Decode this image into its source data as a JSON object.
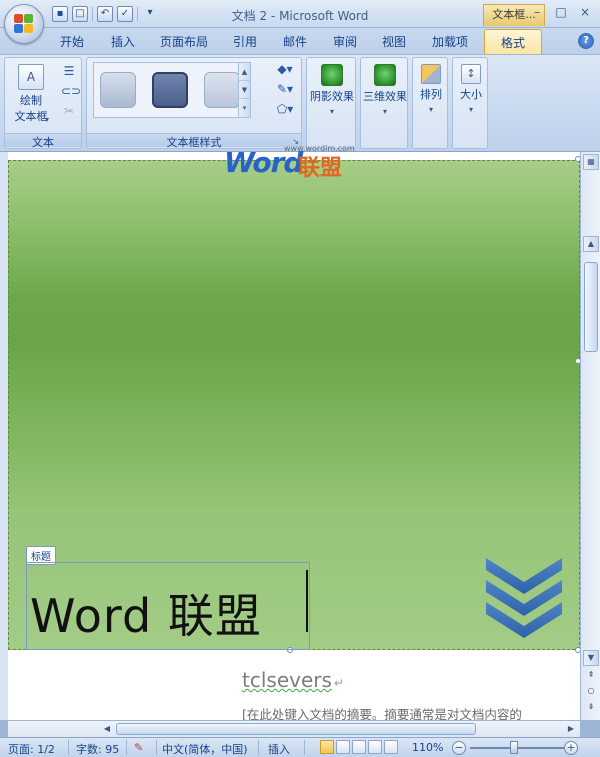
{
  "window": {
    "title": "文档 2 - Microsoft Word",
    "contextual_tab_title": "文本框...",
    "buttons": {
      "minimize": "–",
      "maximize": "□",
      "close": "×"
    }
  },
  "quick_access": {
    "icons": [
      "save-icon",
      "new-document-icon",
      "undo-icon",
      "spelling-icon",
      "customize-icon"
    ]
  },
  "tabs": [
    "开始",
    "插入",
    "页面布局",
    "引用",
    "邮件",
    "审阅",
    "视图",
    "加载项",
    "格式"
  ],
  "active_tab": "格式",
  "ribbon": {
    "group_text": {
      "label": "文本",
      "draw_textbox_line1": "绘制",
      "draw_textbox_line2": "文本框"
    },
    "group_styles": {
      "label": "文本框样式",
      "swatches": [
        "#b5c3d8",
        "#5a6e97",
        "#c5d0e2"
      ]
    },
    "shadow_effects": "阴影效果",
    "3d_effects": "三维效果",
    "arrange": "排列",
    "size": "大小"
  },
  "watermark": {
    "word": "Word",
    "cn": "联盟",
    "url": "www.wordlm.com"
  },
  "document": {
    "title_tag": "标题",
    "title_text": "Word  联盟",
    "author": "tclsevers",
    "abstract": "[在此处键入文档的摘要。摘要通常是对文档内容的"
  },
  "statusbar": {
    "page": "页面: 1/2",
    "words": "字数: 95",
    "language": "中文(简体，中国)",
    "mode": "插入",
    "zoom": "110%",
    "zoom_level": 110
  },
  "colors": {
    "ribbon_accent": "#fbe6a3",
    "chevron": "#3f74b8",
    "green_top": "#a7cd88",
    "green_mid": "#6aa648"
  }
}
